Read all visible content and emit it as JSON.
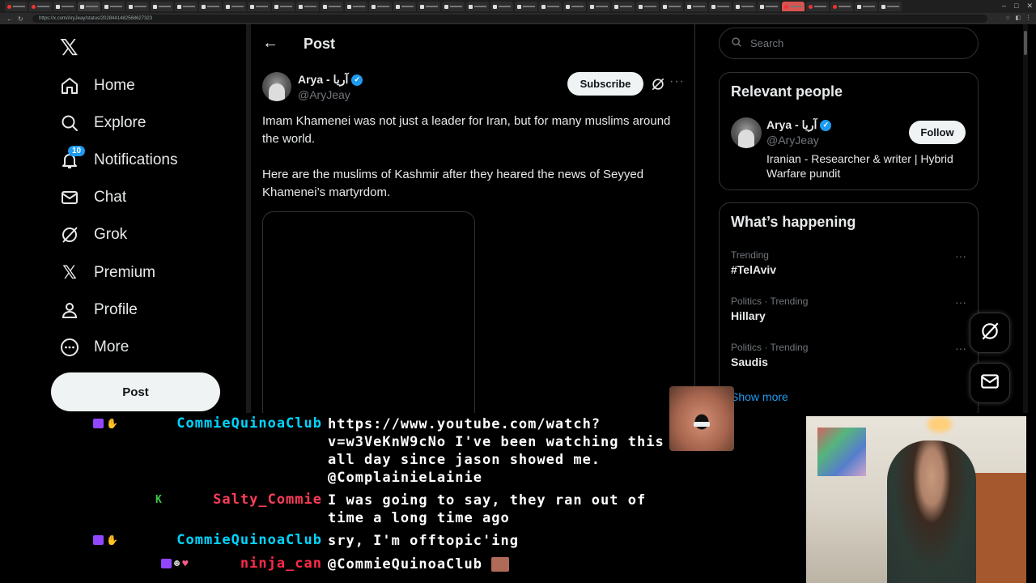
{
  "browser": {
    "url": "https://x.com/AryJeay/status/2028441482568627323"
  },
  "sidebar": {
    "items": [
      {
        "label": "Home",
        "icon": "home-icon"
      },
      {
        "label": "Explore",
        "icon": "search-icon"
      },
      {
        "label": "Notifications",
        "icon": "bell-icon",
        "badge": "10"
      },
      {
        "label": "Chat",
        "icon": "mail-icon"
      },
      {
        "label": "Grok",
        "icon": "grok-icon"
      },
      {
        "label": "Premium",
        "icon": "x-logo-icon"
      },
      {
        "label": "Profile",
        "icon": "person-icon"
      },
      {
        "label": "More",
        "icon": "more-circle-icon"
      }
    ],
    "post_button": "Post"
  },
  "main": {
    "header_title": "Post",
    "tweet": {
      "author_name": "Arya - آریا",
      "author_handle": "@AryJeay",
      "subscribe_label": "Subscribe",
      "text_1": "Imam Khamenei was not just a leader for Iran, but for many muslims around the world.",
      "text_2": "Here are the muslims of Kashmir after they heared the news of Seyyed Khamenei’s martyrdom."
    }
  },
  "right": {
    "search_placeholder": "Search",
    "relevant_title": "Relevant people",
    "relevant_person": {
      "name": "Arya - آریا",
      "handle": "@AryJeay",
      "bio": "Iranian - Researcher & writer | Hybrid Warfare pundit",
      "follow_label": "Follow"
    },
    "happening_title": "What’s happening",
    "trends": [
      {
        "category": "Trending",
        "title": "#TelAviv"
      },
      {
        "category": "Politics · Trending",
        "title": "Hillary"
      },
      {
        "category": "Politics · Trending",
        "title": "Saudis"
      }
    ],
    "show_more": "Show more"
  },
  "chat": {
    "messages": [
      {
        "user": "CommieQuinoaClub",
        "color": "#00d5ff",
        "lines": [
          "https://www.youtube.com/watch?",
          "v=w3VeKnW9cNo I've been watching this",
          "all day since jason showed me.",
          "@ComplainieLainie"
        ]
      },
      {
        "user": "Salty_Commie",
        "color": "#ff3d5a",
        "lines": [
          "I was going to say, they ran out of",
          "time a long time ago"
        ]
      },
      {
        "user": "CommieQuinoaClub",
        "color": "#00d5ff",
        "lines": [
          "sry, I'm offtopic'ing"
        ]
      },
      {
        "user": "ninja_can",
        "color": "#ff2a4a",
        "lines": [
          "@CommieQuinoaClub"
        ]
      }
    ]
  },
  "colors": {
    "accent": "#1d9bf0",
    "background": "#000000",
    "text": "#e7e9ea",
    "muted": "#71767b"
  }
}
